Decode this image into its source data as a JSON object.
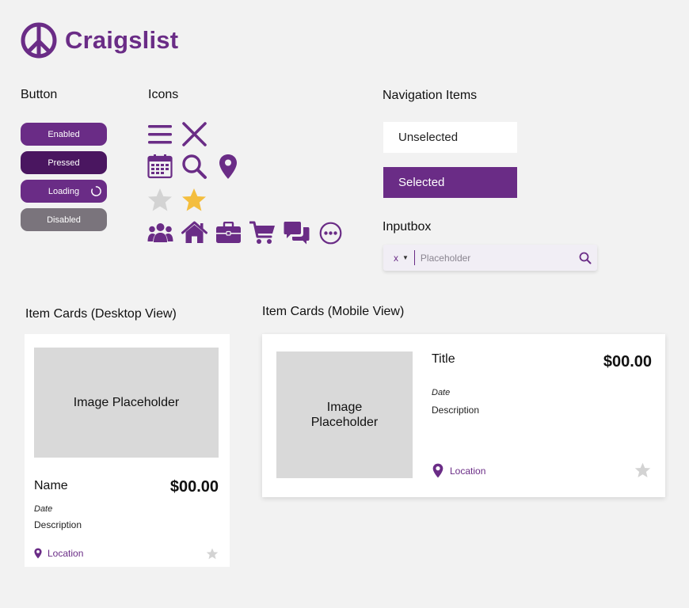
{
  "logo": {
    "text": "Craigslist",
    "icon": "peace-sign-icon"
  },
  "colors": {
    "primary": "#6a2c86",
    "pressed": "#4a1660",
    "disabled": "#7a747c",
    "star_gray": "#d3d3d3",
    "star_gold": "#f4be3e"
  },
  "sections": {
    "button": "Button",
    "icons": "Icons",
    "navigation": "Navigation Items",
    "inputbox": "Inputbox",
    "cards_desktop": "Item Cards (Desktop View)",
    "cards_mobile": "Item Cards (Mobile View)"
  },
  "buttons": {
    "enabled": "Enabled",
    "pressed": "Pressed",
    "loading": "Loading",
    "disabled": "Disabled"
  },
  "icons": [
    "menu-icon",
    "close-icon",
    "calendar-icon",
    "search-icon",
    "location-pin-icon",
    "star-outline-icon",
    "star-filled-icon",
    "users-icon",
    "home-icon",
    "briefcase-icon",
    "cart-icon",
    "chat-icon",
    "more-icon"
  ],
  "nav": {
    "unselected": "Unselected",
    "selected": "Selected"
  },
  "inputbox": {
    "selector_value": "x",
    "placeholder": "Placeholder"
  },
  "card_desktop": {
    "image": "Image Placeholder",
    "name": "Name",
    "price": "$00.00",
    "date": "Date",
    "description": "Description",
    "location": "Location"
  },
  "card_mobile": {
    "image_line1": "Image",
    "image_line2": "Placeholder",
    "title": "Title",
    "price": "$00.00",
    "date": "Date",
    "description": "Description",
    "location": "Location"
  }
}
